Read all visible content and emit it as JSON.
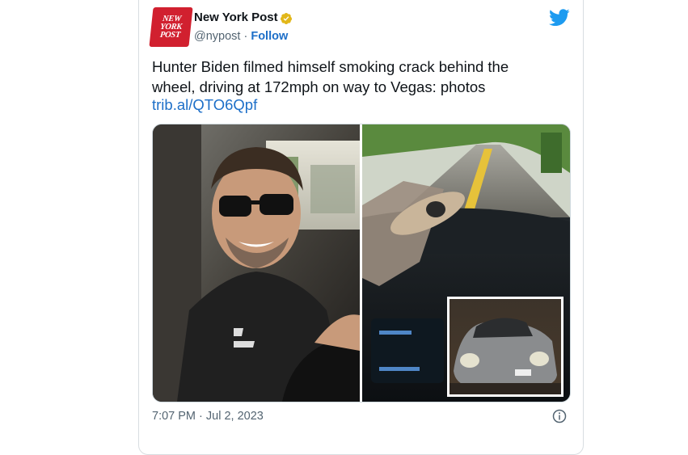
{
  "account": {
    "logo_lines": [
      "NEW",
      "YORK",
      "POST"
    ],
    "name": "New York Post",
    "handle": "@nypost",
    "separator": " · ",
    "follow_label": "Follow",
    "verified_color": "#e2b719",
    "brand_color": "#d1202f"
  },
  "tweet": {
    "line1": "Hunter Biden filmed himself smoking crack behind the",
    "line2": "wheel, driving at 172mph on way to Vegas: photos",
    "link": "trib.al/QTO6Qpf"
  },
  "media": {
    "left_photo": "man-in-car-photo",
    "right_photo": "dashboard-photo",
    "inset_photo": "car-photo"
  },
  "footer": {
    "timestamp": "7:07 PM · Jul 2, 2023"
  },
  "icons": {
    "platform": "twitter-bird-icon",
    "info": "info-icon",
    "verified": "verified-badge-icon"
  },
  "accent_color": "#1d9bf0"
}
